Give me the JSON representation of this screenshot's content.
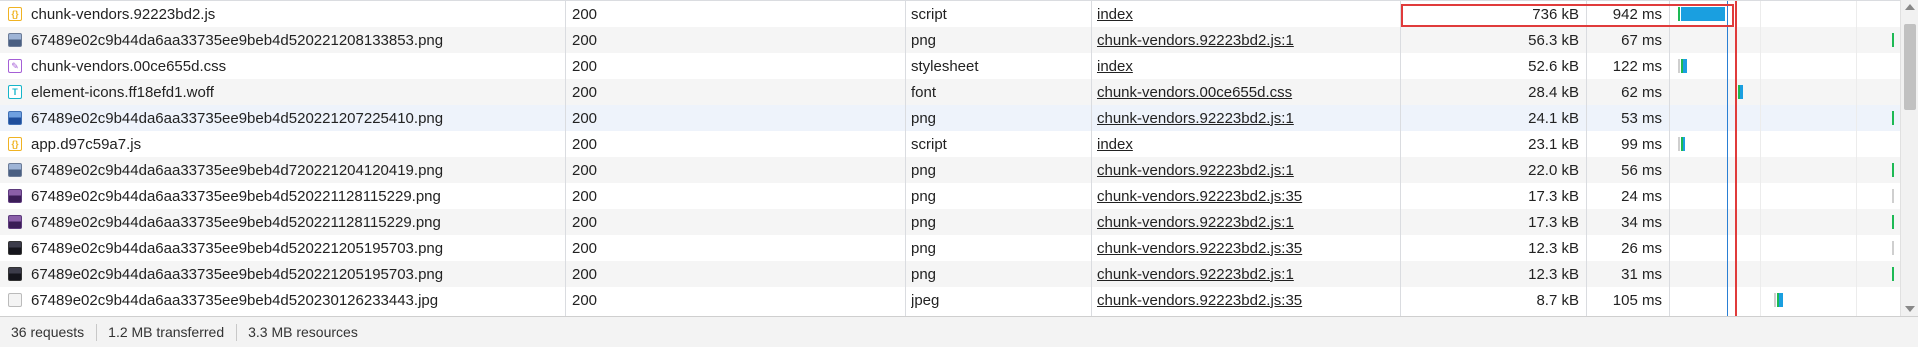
{
  "rows": [
    {
      "name": "chunk-vendors.92223bd2.js",
      "icon": "js-file-icon",
      "status": "200",
      "type": "script",
      "initiator": "index",
      "size": "736 kB",
      "time": "942 ms"
    },
    {
      "name": "67489e02c9b44da6aa33735ee9beb4d520221208133853.png",
      "icon": "image-file-icon",
      "status": "200",
      "type": "png",
      "initiator": "chunk-vendors.92223bd2.js:1",
      "size": "56.3 kB",
      "time": "67 ms"
    },
    {
      "name": "chunk-vendors.00ce655d.css",
      "icon": "css-file-icon",
      "status": "200",
      "type": "stylesheet",
      "initiator": "index",
      "size": "52.6 kB",
      "time": "122 ms"
    },
    {
      "name": "element-icons.ff18efd1.woff",
      "icon": "font-file-icon",
      "status": "200",
      "type": "font",
      "initiator": "chunk-vendors.00ce655d.css",
      "size": "28.4 kB",
      "time": "62 ms"
    },
    {
      "name": "67489e02c9b44da6aa33735ee9beb4d520221207225410.png",
      "icon": "image-file-icon",
      "status": "200",
      "type": "png",
      "initiator": "chunk-vendors.92223bd2.js:1",
      "size": "24.1 kB",
      "time": "53 ms"
    },
    {
      "name": "app.d97c59a7.js",
      "icon": "js-file-icon",
      "status": "200",
      "type": "script",
      "initiator": "index",
      "size": "23.1 kB",
      "time": "99 ms"
    },
    {
      "name": "67489e02c9b44da6aa33735ee9beb4d720221204120419.png",
      "icon": "image-file-icon",
      "status": "200",
      "type": "png",
      "initiator": "chunk-vendors.92223bd2.js:1",
      "size": "22.0 kB",
      "time": "56 ms"
    },
    {
      "name": "67489e02c9b44da6aa33735ee9beb4d520221128115229.png",
      "icon": "image-file-icon",
      "status": "200",
      "type": "png",
      "initiator": "chunk-vendors.92223bd2.js:35",
      "size": "17.3 kB",
      "time": "24 ms"
    },
    {
      "name": "67489e02c9b44da6aa33735ee9beb4d520221128115229.png",
      "icon": "image-file-icon",
      "status": "200",
      "type": "png",
      "initiator": "chunk-vendors.92223bd2.js:1",
      "size": "17.3 kB",
      "time": "34 ms"
    },
    {
      "name": "67489e02c9b44da6aa33735ee9beb4d520221205195703.png",
      "icon": "image-file-icon",
      "status": "200",
      "type": "png",
      "initiator": "chunk-vendors.92223bd2.js:35",
      "size": "12.3 kB",
      "time": "26 ms"
    },
    {
      "name": "67489e02c9b44da6aa33735ee9beb4d520221205195703.png",
      "icon": "image-file-icon",
      "status": "200",
      "type": "png",
      "initiator": "chunk-vendors.92223bd2.js:1",
      "size": "12.3 kB",
      "time": "31 ms"
    },
    {
      "name": "67489e02c9b44da6aa33735ee9beb4d520230126233443.jpg",
      "icon": "image-file-icon",
      "status": "200",
      "type": "jpeg",
      "initiator": "chunk-vendors.92223bd2.js:35",
      "size": "8.7 kB",
      "time": "105 ms"
    }
  ],
  "footer": {
    "requests": "36 requests",
    "transferred": "1.2 MB transferred",
    "resources": "3.3 MB resources"
  },
  "colors": {
    "highlight_box": "#e03b3b",
    "dom_loaded_marker": "#2a7fd4",
    "load_marker": "#e03b3b",
    "waterfall_download": "#1a9fe0",
    "waterfall_waiting": "#1db954"
  }
}
